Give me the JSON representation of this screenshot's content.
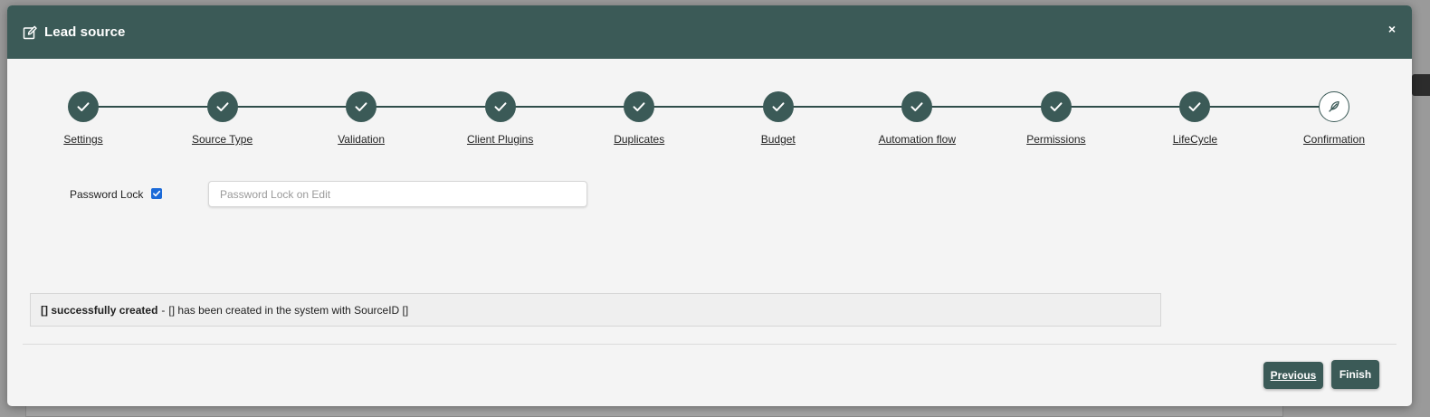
{
  "modal": {
    "title": "Lead source",
    "icon": "edit-icon",
    "close_label": "×"
  },
  "stepper": {
    "steps": [
      {
        "label": "Settings",
        "status": "complete"
      },
      {
        "label": "Source Type",
        "status": "complete"
      },
      {
        "label": "Validation",
        "status": "complete"
      },
      {
        "label": "Client Plugins",
        "status": "complete"
      },
      {
        "label": "Duplicates",
        "status": "complete"
      },
      {
        "label": "Budget",
        "status": "complete"
      },
      {
        "label": "Automation flow",
        "status": "complete"
      },
      {
        "label": "Permissions",
        "status": "complete"
      },
      {
        "label": "LifeCycle",
        "status": "complete"
      },
      {
        "label": "Confirmation",
        "status": "current"
      }
    ]
  },
  "form": {
    "password_lock_label": "Password Lock",
    "password_lock_checked": true,
    "password_lock_placeholder": "Password Lock on Edit",
    "password_lock_value": ""
  },
  "alert": {
    "strong_text": "[] successfully created",
    "separator": "-",
    "message": "[] has been created in the system with SourceID []"
  },
  "footer": {
    "previous_label": "Previous",
    "finish_label": "Finish"
  },
  "colors": {
    "brand": "#3b5a57",
    "checkbox": "#1b6ad8"
  }
}
